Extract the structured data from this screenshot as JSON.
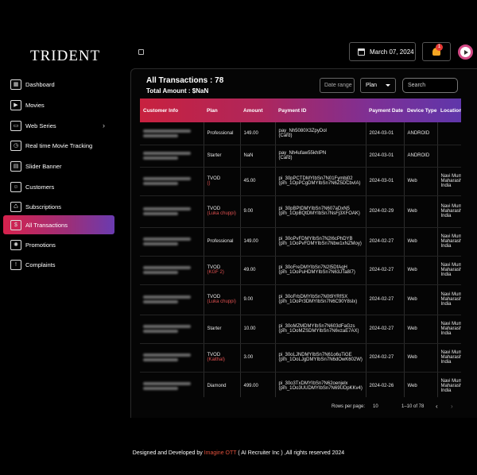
{
  "app": {
    "logo": "TRIDENT"
  },
  "header": {
    "date": "March 07, 2024",
    "notification_count": "1"
  },
  "sidebar": {
    "items": [
      {
        "label": "Dashboard",
        "icon": "dashboard-icon"
      },
      {
        "label": "Movies",
        "icon": "movie-icon"
      },
      {
        "label": "Web Series",
        "icon": "tv-icon"
      },
      {
        "label": "Real time Movie Tracking",
        "icon": "tracking-icon"
      },
      {
        "label": "Slider Banner",
        "icon": "slider-icon"
      },
      {
        "label": "Customers",
        "icon": "customers-icon"
      },
      {
        "label": "Subscriptions",
        "icon": "subscriptions-icon"
      },
      {
        "label": "All Transactions",
        "icon": "transactions-icon"
      },
      {
        "label": "Promotions",
        "icon": "promotions-icon"
      },
      {
        "label": "Complaints",
        "icon": "complaints-icon"
      }
    ],
    "active": "All Transactions"
  },
  "main": {
    "title": "All Transactions : 78",
    "total_amount": "Total Amount : $NaN",
    "date_range_placeholder": "Date range",
    "plan_filter": "Plan",
    "search_placeholder": "Search"
  },
  "table": {
    "columns": [
      "Customer Info",
      "Plan",
      "Amount",
      "Payment ID",
      "Payment Date",
      "Device Type",
      "Location"
    ],
    "rows": [
      {
        "plan": "Professional",
        "plan_extra": "",
        "amount": "149.00",
        "payment_id": "pay_Nh5080X3ZpyDol",
        "payment_sub": "(Card)",
        "date": "2024-03-01",
        "device": "ANDROID",
        "location": ""
      },
      {
        "plan": "Starter",
        "plan_extra": "",
        "amount": "NaN",
        "payment_id": "pay_Nh4ufaw55khIPN",
        "payment_sub": "(Card)",
        "date": "2024-03-01",
        "device": "ANDROID",
        "location": ""
      },
      {
        "plan": "TVOD",
        "plan_extra": "()",
        "amount": "45.00",
        "payment_id": "pi_30pPCTDMYIbSn7N01Fymbj02",
        "payment_sub": "(pm_1OpPCgDMYIbSn7N6Z5DCbvIA)",
        "date": "2024-03-01",
        "device": "Web",
        "location": "Navi Mumbai Maharashtra India"
      },
      {
        "plan": "TVOD",
        "plan_extra": "(Luka chuppi)",
        "amount": "9.00",
        "payment_id": "pi_30pBPtDMYIbSn7N607aDxN5",
        "payment_sub": "(pm_1OpBQtDMYIbSn7NsFj3XFOAK)",
        "date": "2024-02-29",
        "device": "Web",
        "location": "Navi Mumbai Maharashtra India"
      },
      {
        "plan": "Professional",
        "plan_extra": "",
        "amount": "149.00",
        "payment_id": "pi_30oPvFDMYIbSn7N2I6cPhDYB",
        "payment_sub": "(pm_1OoPvFDMYIbSn7Nbw1xNZMoy)",
        "date": "2024-02-27",
        "device": "Web",
        "location": "Navi Mumbai Maharashtra India"
      },
      {
        "plan": "TVOD",
        "plan_extra": "(KGF 2)",
        "amount": "49.00",
        "payment_id": "pi_30oFreDMYIbSn7N2I5DfAqH",
        "payment_sub": "(pm_1OoPuHDMYIbSn7N63JTa8I7)",
        "date": "2024-02-27",
        "device": "Web",
        "location": "Navi Mumbai Maharashtra India"
      },
      {
        "plan": "TVOD",
        "plan_extra": "(Luka chuppi)",
        "amount": "9.00",
        "payment_id": "pi_30oFrbDMYIbSn7N0t9YRfSX",
        "payment_sub": "(pm_1OoPr3DMYIbSn7N6C90Y8slx)",
        "date": "2024-02-27",
        "device": "Web",
        "location": "Navi Mumbai Maharashtra India"
      },
      {
        "plan": "Starter",
        "plan_extra": "",
        "amount": "10.00",
        "payment_id": "pi_30oMZMDMYIbSn7N603dFaGzs",
        "payment_sub": "(pm_1OoMZSDMYIbSn7N6vzaE7AX)",
        "date": "2024-02-27",
        "device": "Web",
        "location": "Navi Mumbai Maharashtra India"
      },
      {
        "plan": "TVOD",
        "plan_extra": "(Kaithal)",
        "amount": "3.00",
        "payment_id": "pi_30oLJNDMYIbSn7N61o6uTiGE",
        "payment_sub": "(pm_1OoLJgDMYIbSn7N6dOwK602W)",
        "date": "2024-02-27",
        "device": "Web",
        "location": "Navi Mumbai Maharashtra India"
      },
      {
        "plan": "Diamond",
        "plan_extra": "",
        "amount": "499.00",
        "payment_id": "pi_30o3TxDMYIbSn7N62oenjelx",
        "payment_sub": "(pm_1Oo3UUDMYIbSn7N69UDpKKv4)",
        "date": "2024-02-26",
        "device": "Web",
        "location": "Navi Mumbai Maharashtra India"
      }
    ]
  },
  "pagination": {
    "rows_label": "Rows per page:",
    "rows_value": "10",
    "range": "1–10 of 78"
  },
  "footer": {
    "prefix": "Designed and Developed by",
    "brand": "Imagine OTT",
    "suffix": "( AI Recruiter Inc ) ,All rights reserved 2024"
  },
  "colors": {
    "accent_red": "#d6224d",
    "accent_purple": "#6a3bb0",
    "bell": "#f5a623",
    "tvod_note": "#e05050"
  }
}
